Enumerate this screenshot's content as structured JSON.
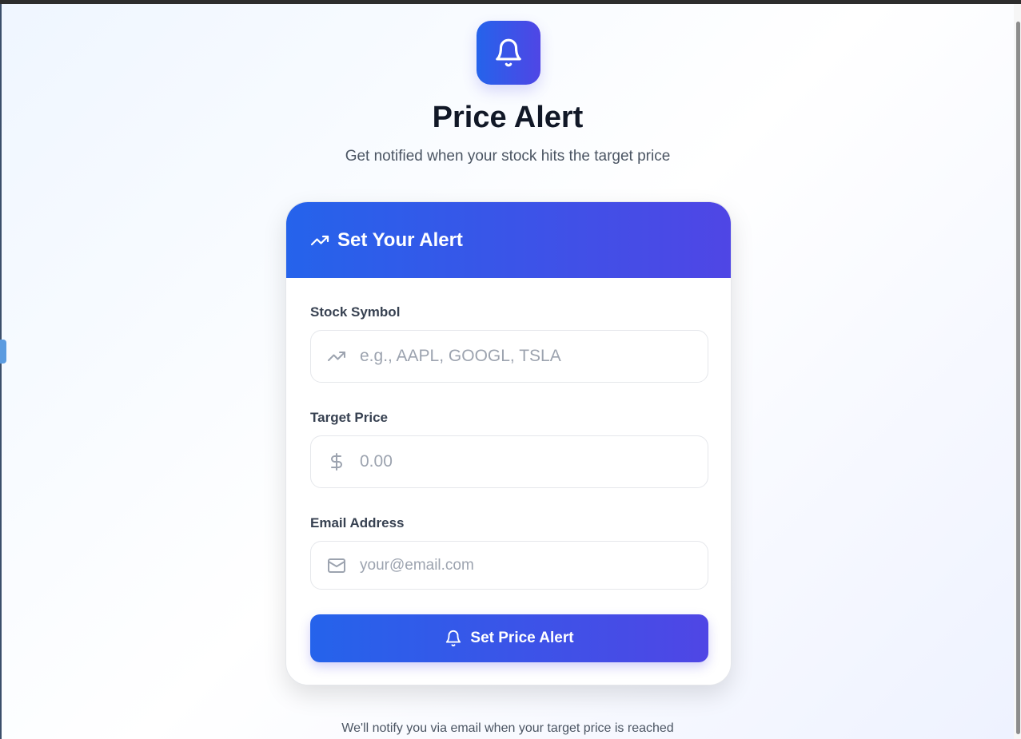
{
  "header": {
    "title": "Price Alert",
    "subtitle": "Get notified when your stock hits the target price"
  },
  "card": {
    "title": "Set Your Alert",
    "fields": [
      {
        "label": "Stock Symbol",
        "placeholder": "e.g., AAPL, GOOGL, TSLA",
        "icon": "trending-up-icon"
      },
      {
        "label": "Target Price",
        "placeholder": "0.00",
        "icon": "dollar-icon"
      },
      {
        "label": "Email Address",
        "placeholder": "your@email.com",
        "icon": "mail-icon"
      }
    ],
    "submit_label": "Set Price Alert"
  },
  "footer": {
    "note": "We'll notify you via email when your target price is reached"
  },
  "colors": {
    "accent_start": "#2563eb",
    "accent_end": "#4f46e5"
  }
}
